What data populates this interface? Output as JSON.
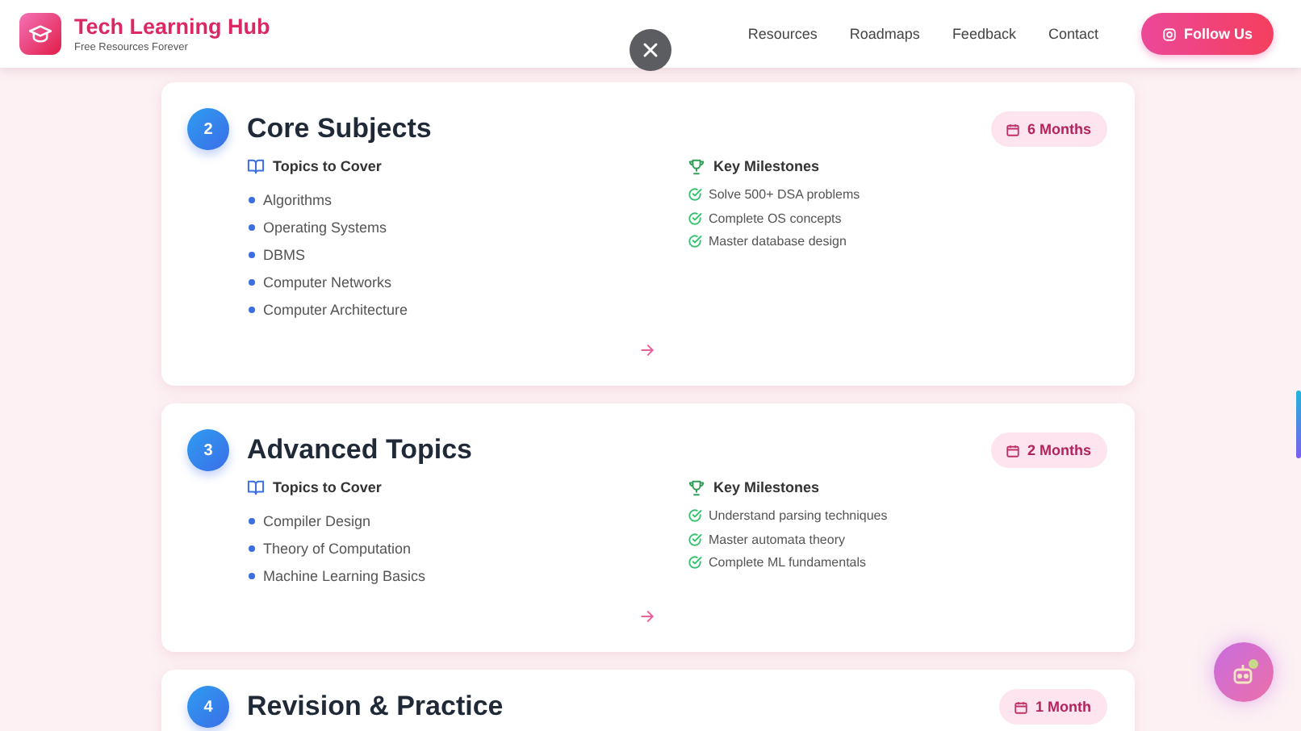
{
  "header": {
    "title": "Tech Learning Hub",
    "subtitle": "Free Resources Forever",
    "nav": [
      "Resources",
      "Roadmaps",
      "Feedback",
      "Contact"
    ],
    "follow_button": "Follow Us"
  },
  "stages": [
    {
      "number": "2",
      "title": "Core Subjects",
      "duration": "6 Months",
      "topics_heading": "Topics to Cover",
      "topics": [
        "Algorithms",
        "Operating Systems",
        "DBMS",
        "Computer Networks",
        "Computer Architecture"
      ],
      "milestones_heading": "Key Milestones",
      "milestones": [
        "Solve 500+ DSA problems",
        "Complete OS concepts",
        "Master database design"
      ]
    },
    {
      "number": "3",
      "title": "Advanced Topics",
      "duration": "2 Months",
      "topics_heading": "Topics to Cover",
      "topics": [
        "Compiler Design",
        "Theory of Computation",
        "Machine Learning Basics"
      ],
      "milestones_heading": "Key Milestones",
      "milestones": [
        "Understand parsing techniques",
        "Master automata theory",
        "Complete ML fundamentals"
      ]
    },
    {
      "number": "4",
      "title": "Revision & Practice",
      "duration": "1 Month"
    }
  ]
}
